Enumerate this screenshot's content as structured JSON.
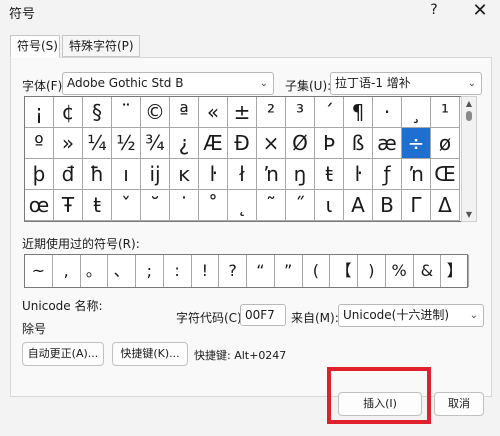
{
  "window": {
    "title": "符号",
    "help": "?",
    "close": "✕"
  },
  "tabs": [
    {
      "label": "符号(S)"
    },
    {
      "label": "特殊字符(P)"
    }
  ],
  "font": {
    "label": "字体(F):",
    "value": "Adobe Gothic Std B"
  },
  "subset": {
    "label": "子集(U):",
    "value": "拉丁语-1 增补"
  },
  "symbols": [
    [
      "¡",
      "¢",
      "§",
      "¨",
      "©",
      "ª",
      "«",
      "±",
      "²",
      "³",
      "´",
      "¶",
      "·",
      "¸",
      "¹"
    ],
    [
      "º",
      "»",
      "¼",
      "½",
      "¾",
      "¿",
      "Æ",
      "Ð",
      "×",
      "Ø",
      "Þ",
      "ß",
      "æ",
      "÷",
      "ø"
    ],
    [
      "þ",
      "đ",
      "ħ",
      "ı",
      "ĳ",
      "ĸ",
      "ŀ",
      "ł",
      "ŉ",
      "ŋ",
      "ŧ",
      "ŀ",
      "ƒ",
      "ŉ",
      "Œ"
    ],
    [
      "œ",
      "Ŧ",
      "ŧ",
      "ˇ",
      "˘",
      "˙",
      "˚",
      "˛",
      "˜",
      "˝",
      "ι",
      "Α",
      "Β",
      "Γ",
      "Δ",
      "Ε"
    ]
  ],
  "selected_symbol": "÷",
  "recent": {
    "label": "近期使用过的符号(R):",
    "symbols": [
      "~",
      ",",
      "。",
      "、",
      ";",
      ":",
      "!",
      "?",
      "“",
      "”",
      "(",
      "【",
      ")",
      "%",
      "&",
      "】"
    ]
  },
  "unicode_name": {
    "label": "Unicode 名称:",
    "value": "除号"
  },
  "char_code": {
    "label": "字符代码(C):",
    "value": "00F7"
  },
  "from": {
    "label": "来自(M):",
    "value": "Unicode(十六进制)"
  },
  "buttons": {
    "autocorrect": "自动更正(A)...",
    "shortcut_key": "快捷键(K)...",
    "insert": "插入(I)",
    "cancel": "取消"
  },
  "shortcut": {
    "text": "快捷键: Alt+0247"
  },
  "colors": {
    "selection": "#1f6fd1",
    "highlight": "#e0202a"
  }
}
